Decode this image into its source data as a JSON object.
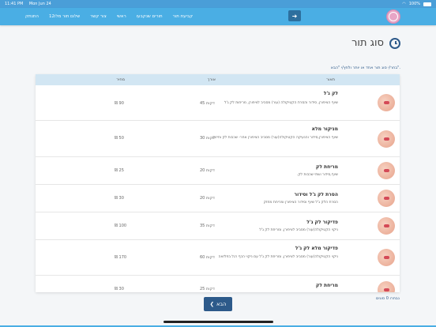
{
  "status_bar": {
    "time": "11:41 PM",
    "date": "Mon Jun 24",
    "battery": "100%"
  },
  "nav": {
    "exit_icon": "arrow-right-icon",
    "links": [
      "קביעת תור",
      "תורים שנקבעו",
      "ראשי",
      "צור קשר",
      "שלום תור מלו12",
      "התנתק"
    ]
  },
  "page": {
    "title": "סוג תור",
    "hint": "בחר/י סוג תור אחד או יותר ולחץ/י \"הבא\"."
  },
  "table": {
    "headers": {
      "description": "תאור",
      "length": "אורך",
      "price": "מחיר"
    },
    "rows": [
      {
        "name": "לק ג'ל",
        "description": "שיוף הציפורן, סידור והסרת הקטיקולה (עור) מסביב לציפורן, מריחות לק ג'ל",
        "length": "45 דקות",
        "price": "₪ 90"
      },
      {
        "name": "מניקור מלא",
        "description": "שיוף הציפורן,סידור והנעיקה הקטיקולה(עור) מסביב הציפורן אחר- שכבות לק וחיזוק",
        "length": "30 דקות",
        "price": "₪ 50"
      },
      {
        "name": "מריחת לק",
        "description": "שיוף,סידור ושתי שכבות לק.",
        "length": "20 דקות",
        "price": "₪ 25"
      },
      {
        "name": "הסרת לק ג'ל וסידור",
        "description": "הסרת הלק ג'ל שיוף וסידור הציפורן ומריחת מחזק",
        "length": "20 דקות",
        "price": "₪ 30"
      },
      {
        "name": "פדיקור לק ג'ל",
        "description": "ניקוי הקטיקולה(עור) מסביב לציפורן, ומריחת לק ג'ל",
        "length": "35 דקות",
        "price": "₪ 100"
      },
      {
        "name": "פדיקור מלא לק ג'ל",
        "description": "ניקוי הקטיקולה(עור) מסביב לציפורן, ומריחת לק ג'ל עם ניקוי הכף רגל בפלזאה",
        "length": "60 דקות",
        "price": "₪ 170"
      },
      {
        "name": "מריחת לק",
        "description": "",
        "length": "25 דקות",
        "price": "₪ 30"
      }
    ]
  },
  "footer": {
    "next_label": "הבא",
    "next_icon": "chevron-left-icon",
    "selected_count": "נבחרו 0 סוגים"
  }
}
